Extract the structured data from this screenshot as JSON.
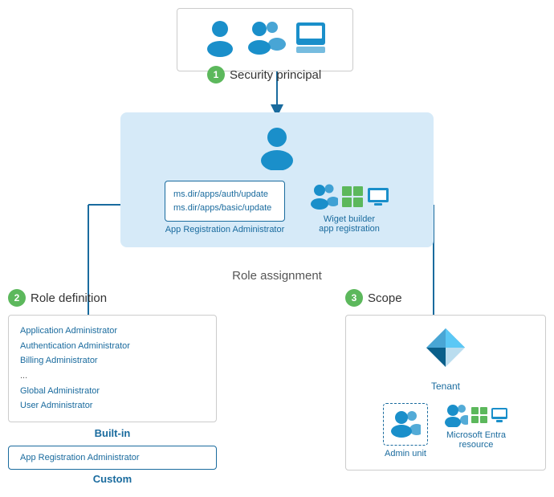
{
  "security_principal": {
    "label": "Security principal",
    "circle": "1"
  },
  "role_assignment": {
    "label": "Role assignment",
    "app_reg_lines": [
      "ms.dir/apps/auth/update",
      "ms.dir/apps/basic/update"
    ],
    "app_reg_label": "App Registration Administrator",
    "widget_label": "Wiget builder\napp registration"
  },
  "role_definition": {
    "circle": "2",
    "title": "Role definition",
    "builtin_items": [
      "Application Administrator",
      "Authentication Administrator",
      "Billing Administrator",
      "...",
      "Global Administrator",
      "User Administrator"
    ],
    "builtin_label": "Built-in",
    "custom_item": "App Registration Administrator",
    "custom_label": "Custom"
  },
  "scope": {
    "circle": "3",
    "title": "Scope",
    "tenant_label": "Tenant",
    "admin_unit_label": "Admin unit",
    "ms_entra_label": "Microsoft Entra\nresource"
  }
}
